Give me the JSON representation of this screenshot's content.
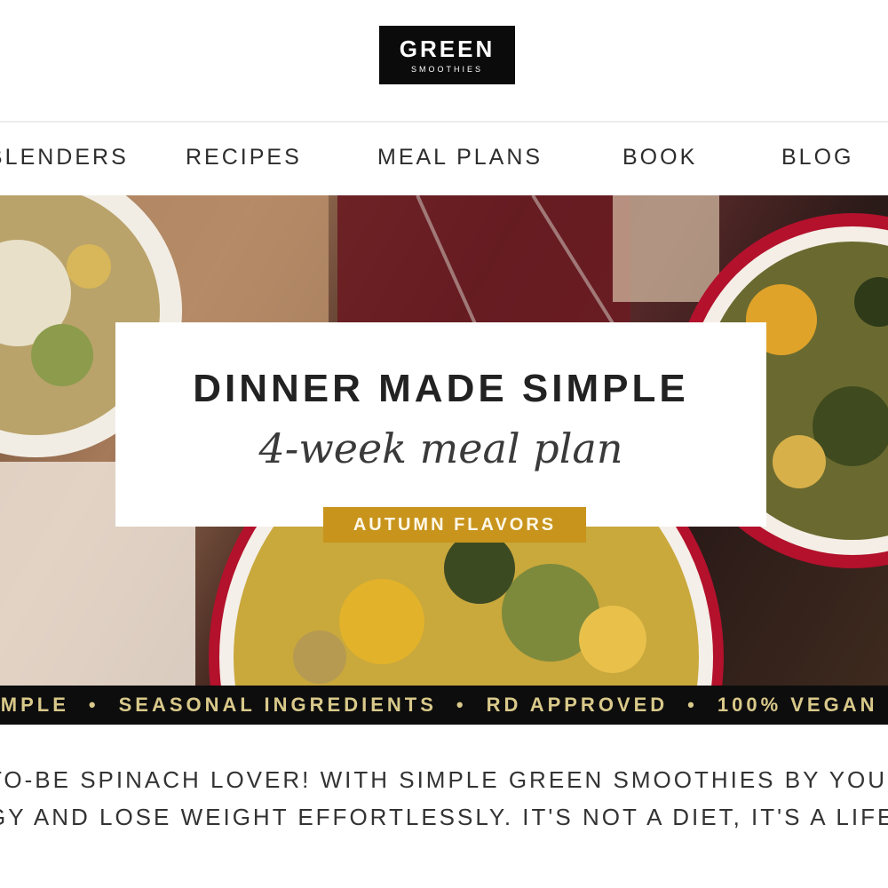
{
  "logo": {
    "main": "GREEN",
    "sub": "SMOOTHIES"
  },
  "nav": {
    "items": [
      {
        "label": "BLENDERS"
      },
      {
        "label": "RECIPES"
      },
      {
        "label": "MEAL PLANS"
      },
      {
        "label": "BOOK"
      },
      {
        "label": "BLOG"
      }
    ]
  },
  "hero": {
    "headline": "DINNER MADE SIMPLE",
    "subhead": "4-week meal plan",
    "tag": "AUTUMN FLAVORS"
  },
  "ticker": {
    "items": [
      "SIMPLE",
      "SEASONAL INGREDIENTS",
      "RD APPROVED",
      "100% VEGAN"
    ],
    "separator": "•"
  },
  "intro": {
    "line1": "TO-BE SPINACH LOVER! WITH SIMPLE GREEN SMOOTHIES BY YOUR SIDE",
    "line2": "GY AND LOSE WEIGHT EFFORTLESSLY. IT'S NOT A DIET, IT'S A LIFESTYLE"
  },
  "colors": {
    "accent": "#c8941c",
    "ticker_bg": "#0d0d0d",
    "ticker_text": "#d9c98a",
    "logo_bg": "#0b0b0b"
  }
}
